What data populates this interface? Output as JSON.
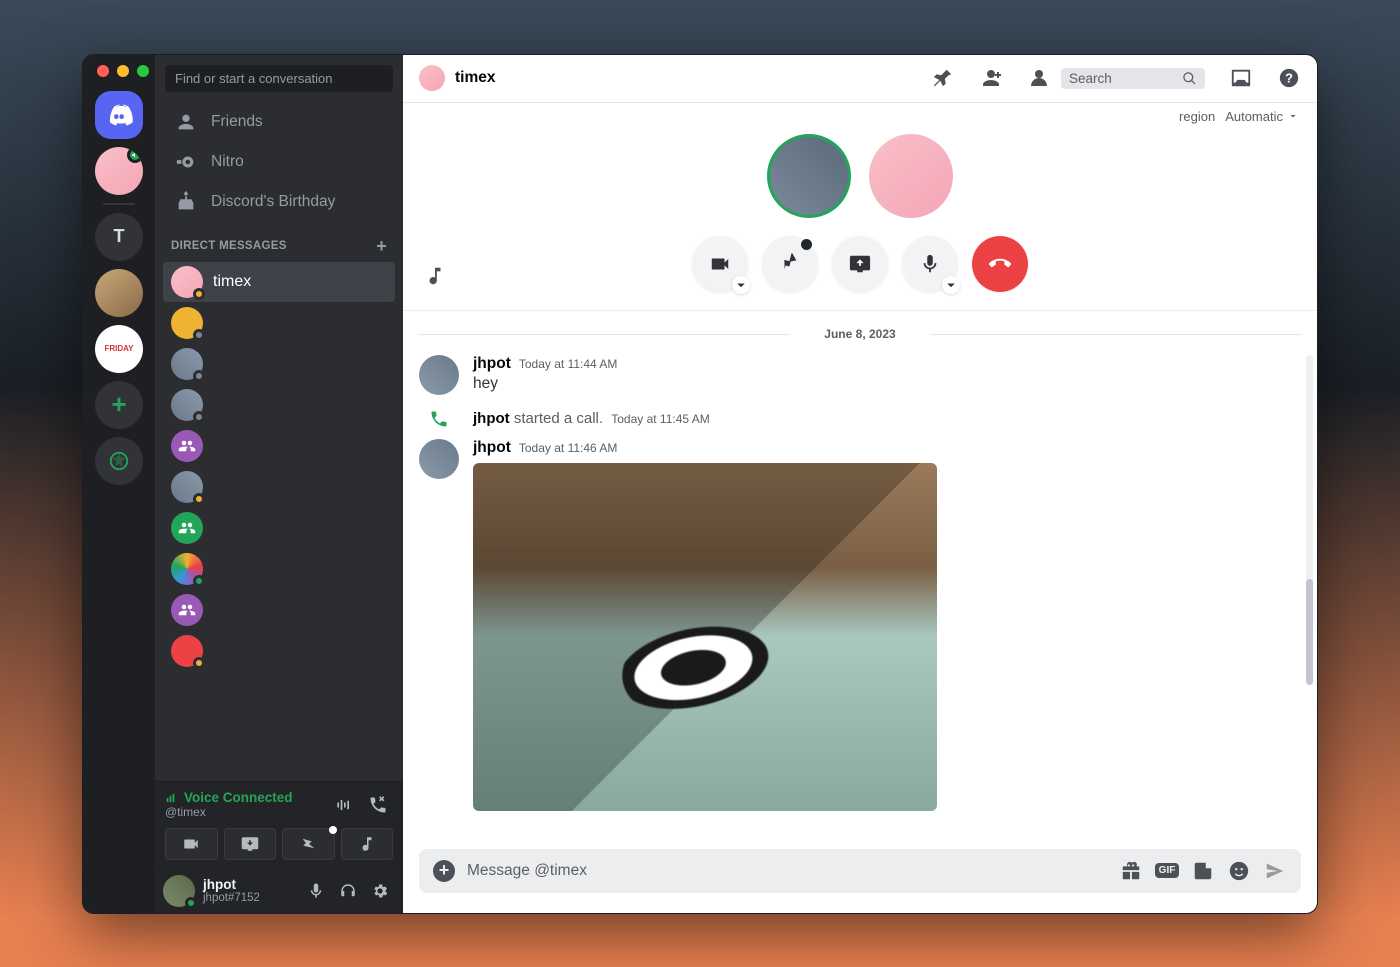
{
  "search_placeholder": "Find or start a conversation",
  "nav": {
    "friends": "Friends",
    "nitro": "Nitro",
    "birthday": "Discord's Birthday"
  },
  "dm_header": "DIRECT MESSAGES",
  "active_dm_name": "timex",
  "voice": {
    "status": "Voice Connected",
    "channel": "@timex"
  },
  "user": {
    "name": "jhpot",
    "tag": "jhpot#7152"
  },
  "chat": {
    "title": "timex",
    "search_placeholder": "Search",
    "region_label": "region",
    "region_value": "Automatic",
    "date_divider": "June 8, 2023",
    "msg1": {
      "author": "jhpot",
      "time": "Today at 11:44 AM",
      "text": "hey"
    },
    "sys": {
      "author": "jhpot",
      "action": " started a call.",
      "time": "Today at 11:45 AM"
    },
    "msg2": {
      "author": "jhpot",
      "time": "Today at 11:46 AM"
    },
    "composer_placeholder": "Message @timex",
    "gif_label": "GIF"
  }
}
